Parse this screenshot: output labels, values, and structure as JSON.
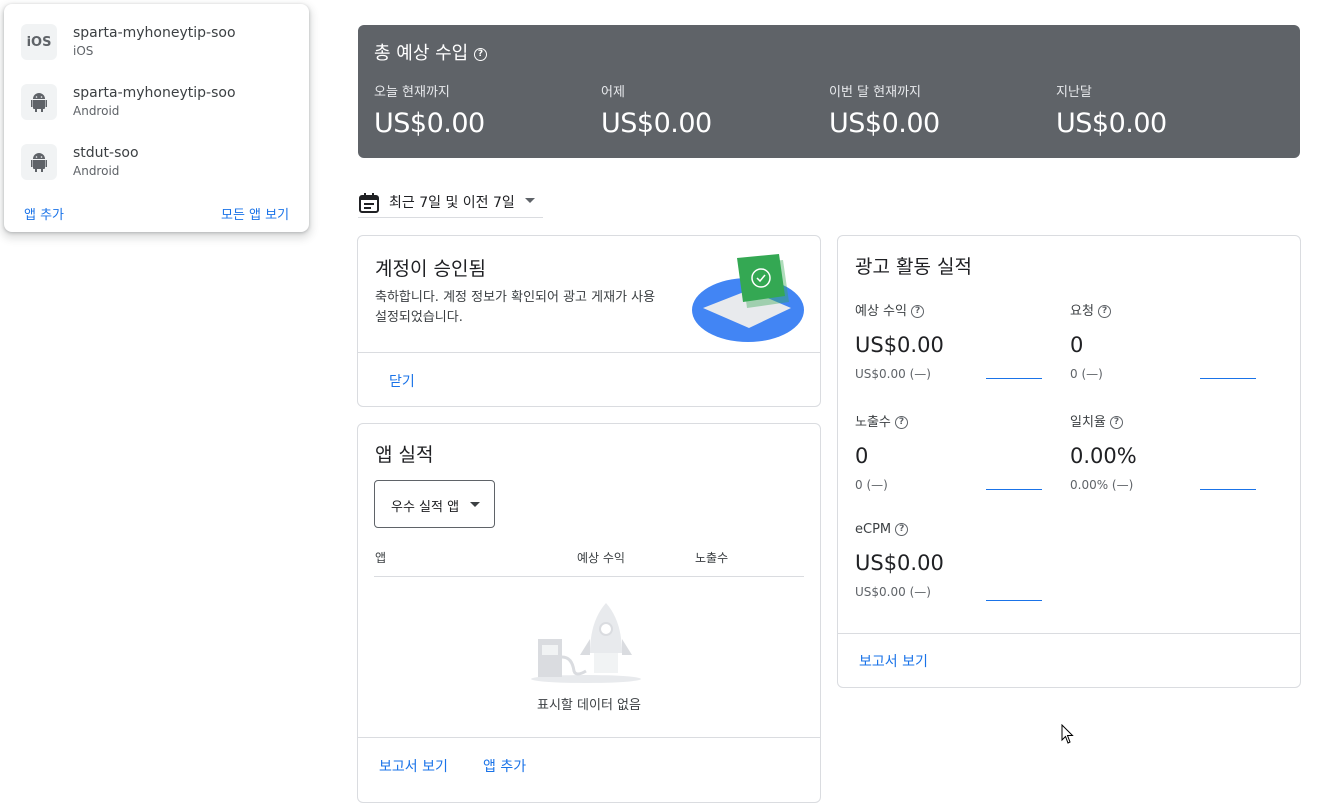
{
  "app_popup": {
    "apps": [
      {
        "name": "sparta-myhoneytip-soo",
        "platform": "iOS",
        "icon": "ios-icon",
        "icon_text": "iOS"
      },
      {
        "name": "sparta-myhoneytip-soo",
        "platform": "Android",
        "icon": "android-icon"
      },
      {
        "name": "stdut-soo",
        "platform": "Android",
        "icon": "android-icon"
      }
    ],
    "add_app": "앱 추가",
    "view_all_apps": "모든 앱 보기"
  },
  "earnings": {
    "title": "총 예상 수입",
    "columns": [
      {
        "label": "오늘 현재까지",
        "value": "US$0.00"
      },
      {
        "label": "어제",
        "value": "US$0.00"
      },
      {
        "label": "이번 달 현재까지",
        "value": "US$0.00"
      },
      {
        "label": "지난달",
        "value": "US$0.00"
      }
    ]
  },
  "date_range": {
    "label": "최근 7일 및 이전 7일"
  },
  "account_card": {
    "title": "계정이 승인됨",
    "body_line1": "축하합니다. 계정 정보가 확인되어 광고 게재가 사용",
    "body_line2": "설정되었습니다.",
    "close": "닫기"
  },
  "app_performance": {
    "title": "앱 실적",
    "dropdown": "우수 실적 앱",
    "columns": [
      "앱",
      "예상 수익",
      "노출수"
    ],
    "empty_text": "표시할 데이터 없음",
    "view_report": "보고서 보기",
    "add_app": "앱 추가"
  },
  "ad_performance": {
    "title": "광고 활동 실적",
    "metrics": [
      {
        "label": "예상 수익",
        "value": "US$0.00",
        "sub": "US$0.00 (—)"
      },
      {
        "label": "요청",
        "value": "0",
        "sub": "0 (—)"
      },
      {
        "label": "노출수",
        "value": "0",
        "sub": "0 (—)"
      },
      {
        "label": "일치율",
        "value": "0.00%",
        "sub": "0.00% (—)"
      },
      {
        "label": "eCPM",
        "value": "US$0.00",
        "sub": "US$0.00 (—)"
      }
    ],
    "view_report": "보고서 보기"
  },
  "colors": {
    "accent": "#1a73e8",
    "banner": "#5f6368",
    "green": "#34a853"
  }
}
